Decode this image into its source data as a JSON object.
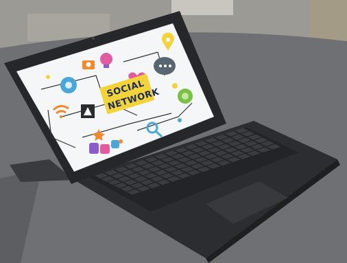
{
  "screen": {
    "line1": "SOCIAL",
    "line2": "NETWORK"
  },
  "colors": {
    "background_wall": "#9c9a94",
    "table_surface": "#6f7073",
    "device_body": "#2c2d30",
    "screen_bg": "#f4f6f7",
    "banner": "#f2d33a",
    "accent_blue": "#4aa6d8",
    "accent_orange": "#f08a2c",
    "accent_pink": "#e25aa0",
    "accent_purple": "#8a5bc9",
    "accent_green": "#7ac043"
  },
  "icons": [
    "wifi-icon",
    "camera-icon",
    "gear-icon",
    "chat-bubble-icon",
    "heart-icon",
    "star-icon",
    "magnifier-icon",
    "person-icon",
    "lightbulb-icon",
    "location-pin-icon",
    "globe-icon",
    "thumbs-up-icon"
  ]
}
